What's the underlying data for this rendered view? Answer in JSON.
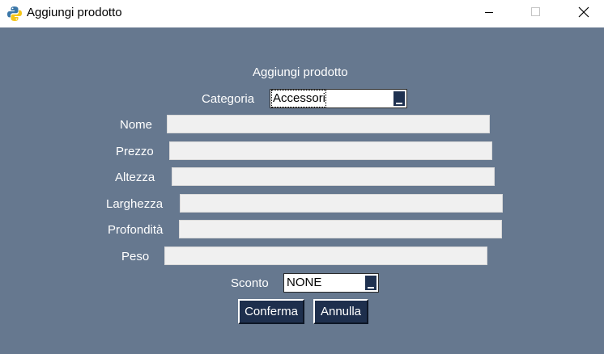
{
  "window": {
    "title": "Aggiungi prodotto",
    "icon": "python-icon",
    "controls": {
      "minimize": "minimize-icon",
      "maximize": "maximize-icon",
      "close": "close-icon"
    }
  },
  "form": {
    "heading": "Aggiungi prodotto",
    "category": {
      "label": "Categoria",
      "value": "Accessori"
    },
    "fields": {
      "nome": {
        "label": "Nome",
        "value": ""
      },
      "prezzo": {
        "label": "Prezzo",
        "value": ""
      },
      "altezza": {
        "label": "Altezza",
        "value": ""
      },
      "larghezza": {
        "label": "Larghezza",
        "value": ""
      },
      "profondita": {
        "label": "Profondità",
        "value": ""
      },
      "peso": {
        "label": "Peso",
        "value": ""
      }
    },
    "discount": {
      "label": "Sconto",
      "value": "NONE"
    },
    "confirm_label": "Conferma",
    "cancel_label": "Annulla"
  },
  "colors": {
    "background": "#66788f",
    "button": "#1e2f4d",
    "field": "#f0f0f0",
    "text": "#ffffff"
  }
}
